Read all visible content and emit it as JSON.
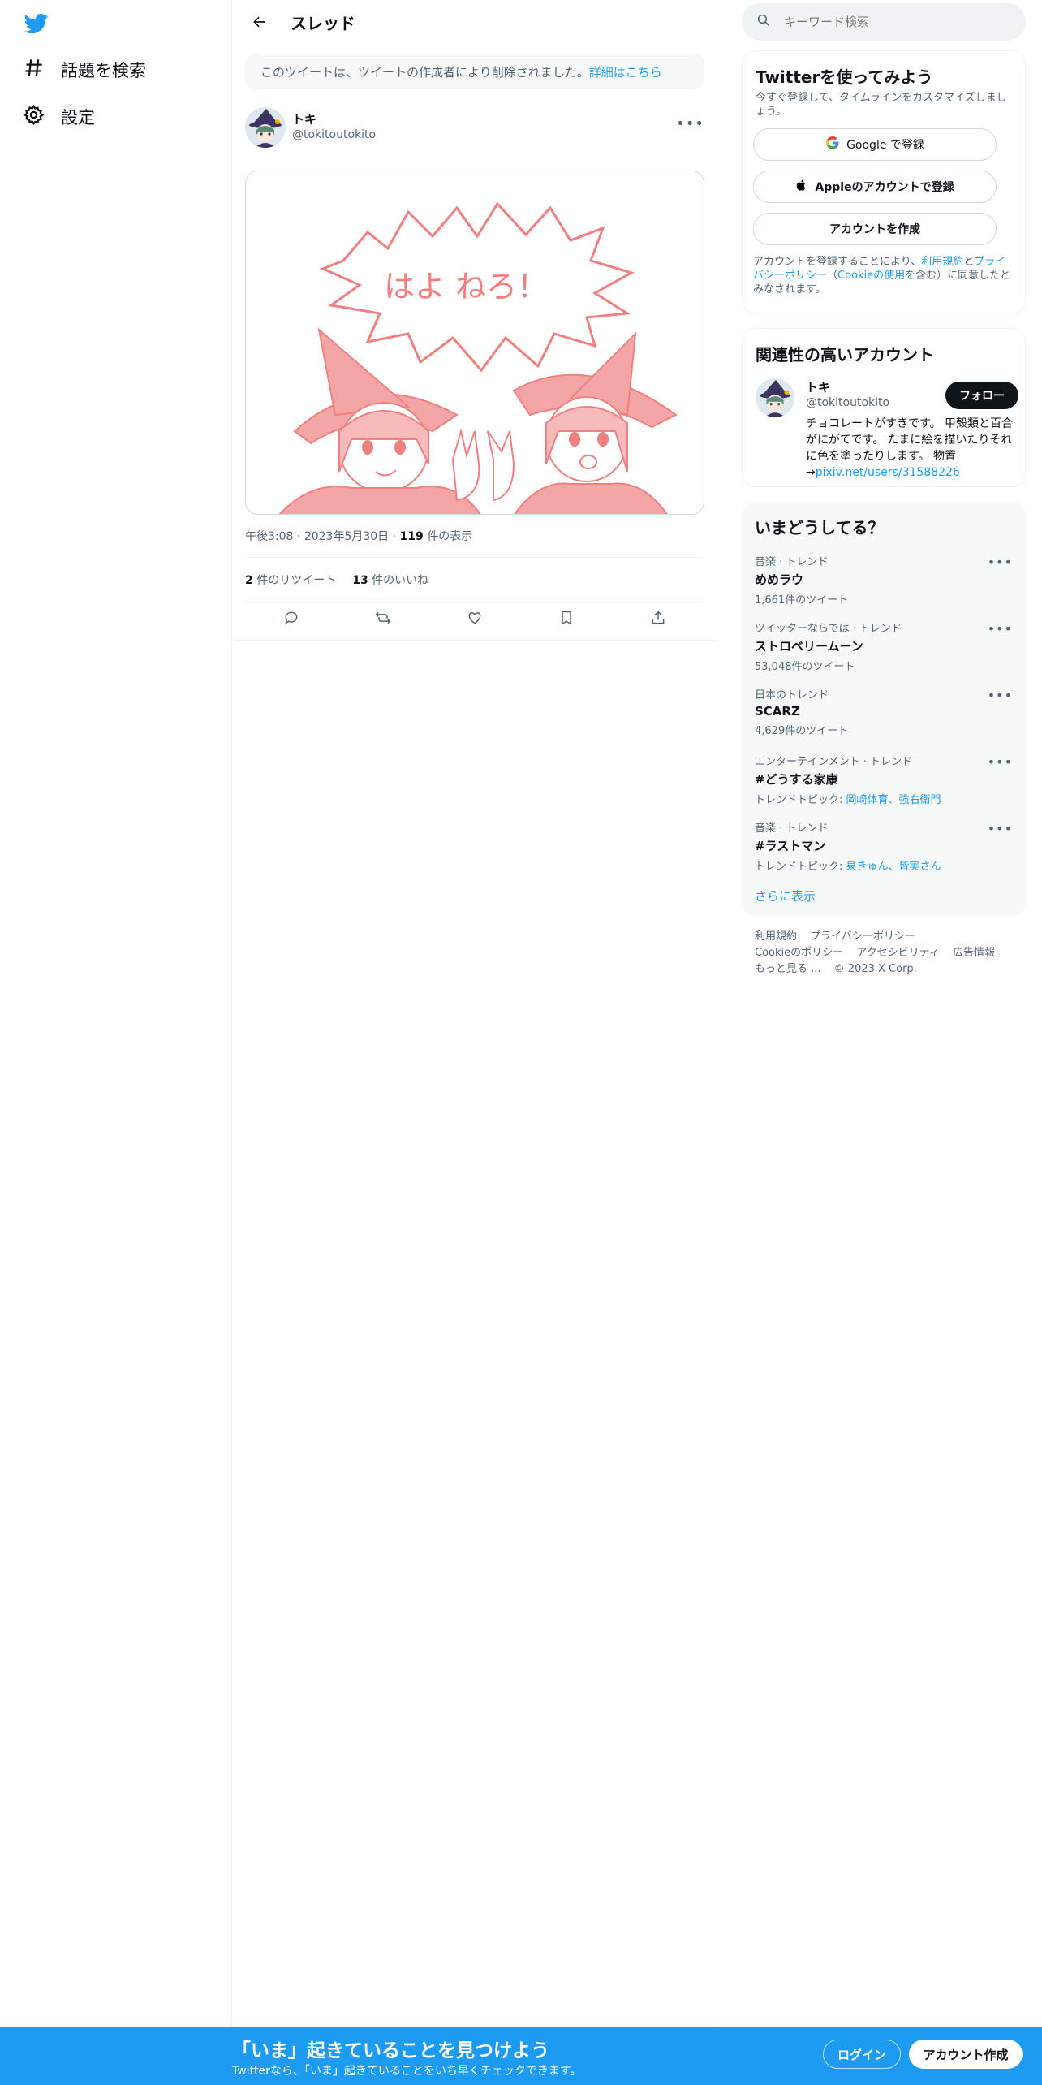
{
  "nav": {
    "items": [
      {
        "label": "話題を検索",
        "icon": "hashtag-icon"
      },
      {
        "label": "設定",
        "icon": "gear-icon"
      }
    ]
  },
  "thread": {
    "title": "スレッド",
    "deleted_notice": "このツイートは、ツイートの作成者により削除されました。",
    "deleted_link": "詳細はこちら",
    "author_name": "トキ",
    "author_handle": "@tokitoutokito",
    "image_text": "はよ ねろ！",
    "time": "午後3:08",
    "date": "2023年5月30日",
    "views_count": "119",
    "views_label": " 件の表示",
    "retweets_count": "2",
    "retweets_label": " 件のリツイート",
    "likes_count": "13",
    "likes_label": " 件のいいね"
  },
  "search": {
    "placeholder": "キーワード検索"
  },
  "signup": {
    "title": "Twitterを使ってみよう",
    "subtitle": "今すぐ登録して、タイムラインをカスタマイズしましょう。",
    "google": "Google で登録",
    "apple": "Appleのアカウントで登録",
    "create": "アカウントを作成",
    "legal_1": "アカウントを登録することにより、",
    "legal_terms": "利用規約",
    "legal_2": "と",
    "legal_privacy": "プライバシーポリシー",
    "legal_3": "（",
    "legal_cookie": "Cookieの使用",
    "legal_4": "を含む）に同意したとみなされます。"
  },
  "related": {
    "title": "関連性の高いアカウント",
    "name": "トキ",
    "handle": "@tokitoutokito",
    "follow": "フォロー",
    "bio": "チョコレートがすきです。 甲殻類と百合がにがてです。 たまに絵を描いたりそれに色を塗ったりします。 物置→",
    "bio_link": "pixiv.net/users/31588226"
  },
  "trends": {
    "title": "いまどうしてる？",
    "items": [
      {
        "category": "音楽 · トレンド",
        "name": "めめラウ",
        "count": "1,661件のツイート",
        "topic_label": "",
        "topic_links": ""
      },
      {
        "category": "ツイッターならでは · トレンド",
        "name": "ストロベリームーン",
        "count": "53,048件のツイート",
        "topic_label": "",
        "topic_links": ""
      },
      {
        "category": "日本のトレンド",
        "name": "SCARZ",
        "count": "4,629件のツイート",
        "topic_label": "",
        "topic_links": ""
      },
      {
        "category": "エンターテインメント · トレンド",
        "name": "#どうする家康",
        "count": "",
        "topic_label": "トレンドトピック: ",
        "topic_links": "岡崎体育、強右衛門"
      },
      {
        "category": "音楽 · トレンド",
        "name": "#ラストマン",
        "count": "",
        "topic_label": "トレンドトピック: ",
        "topic_links": "泉きゅん、皆実さん"
      }
    ],
    "show_more": "さらに表示"
  },
  "footer": {
    "terms": "利用規約",
    "privacy": "プライバシーポリシー",
    "cookie": "Cookieのポリシー",
    "accessibility": "アクセシビリティ",
    "ads": "広告情報",
    "more": "もっと見る ...",
    "copyright": "© 2023 X Corp."
  },
  "bottom": {
    "title": "「いま」起きていることを見つけよう",
    "subtitle": "Twitterなら、「いま」起きていることをいち早くチェックできます。",
    "login": "ログイン",
    "create": "アカウント作成"
  },
  "colors": {
    "accent": "#1d9bf0",
    "text": "#0f1419",
    "muted": "#536471",
    "drawing": "#f08080"
  }
}
